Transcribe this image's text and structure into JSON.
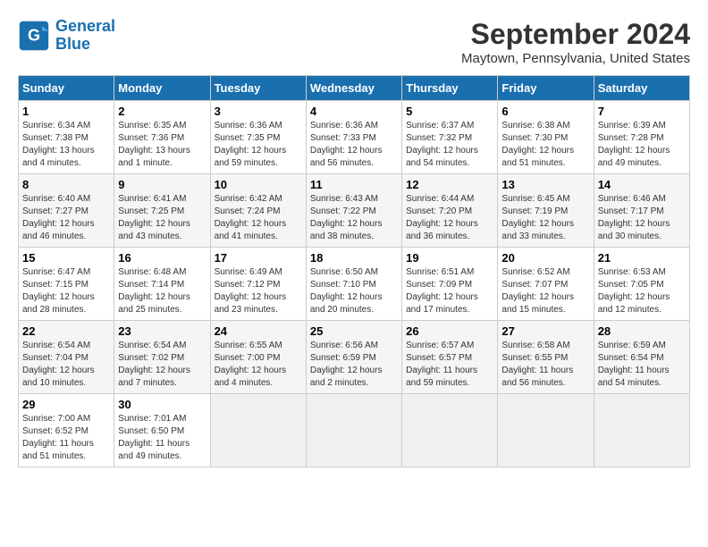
{
  "header": {
    "logo_line1": "General",
    "logo_line2": "Blue",
    "title": "September 2024",
    "subtitle": "Maytown, Pennsylvania, United States"
  },
  "weekdays": [
    "Sunday",
    "Monday",
    "Tuesday",
    "Wednesday",
    "Thursday",
    "Friday",
    "Saturday"
  ],
  "weeks": [
    [
      {
        "day": "1",
        "info": "Sunrise: 6:34 AM\nSunset: 7:38 PM\nDaylight: 13 hours and 4 minutes."
      },
      {
        "day": "2",
        "info": "Sunrise: 6:35 AM\nSunset: 7:36 PM\nDaylight: 13 hours and 1 minute."
      },
      {
        "day": "3",
        "info": "Sunrise: 6:36 AM\nSunset: 7:35 PM\nDaylight: 12 hours and 59 minutes."
      },
      {
        "day": "4",
        "info": "Sunrise: 6:36 AM\nSunset: 7:33 PM\nDaylight: 12 hours and 56 minutes."
      },
      {
        "day": "5",
        "info": "Sunrise: 6:37 AM\nSunset: 7:32 PM\nDaylight: 12 hours and 54 minutes."
      },
      {
        "day": "6",
        "info": "Sunrise: 6:38 AM\nSunset: 7:30 PM\nDaylight: 12 hours and 51 minutes."
      },
      {
        "day": "7",
        "info": "Sunrise: 6:39 AM\nSunset: 7:28 PM\nDaylight: 12 hours and 49 minutes."
      }
    ],
    [
      {
        "day": "8",
        "info": "Sunrise: 6:40 AM\nSunset: 7:27 PM\nDaylight: 12 hours and 46 minutes."
      },
      {
        "day": "9",
        "info": "Sunrise: 6:41 AM\nSunset: 7:25 PM\nDaylight: 12 hours and 43 minutes."
      },
      {
        "day": "10",
        "info": "Sunrise: 6:42 AM\nSunset: 7:24 PM\nDaylight: 12 hours and 41 minutes."
      },
      {
        "day": "11",
        "info": "Sunrise: 6:43 AM\nSunset: 7:22 PM\nDaylight: 12 hours and 38 minutes."
      },
      {
        "day": "12",
        "info": "Sunrise: 6:44 AM\nSunset: 7:20 PM\nDaylight: 12 hours and 36 minutes."
      },
      {
        "day": "13",
        "info": "Sunrise: 6:45 AM\nSunset: 7:19 PM\nDaylight: 12 hours and 33 minutes."
      },
      {
        "day": "14",
        "info": "Sunrise: 6:46 AM\nSunset: 7:17 PM\nDaylight: 12 hours and 30 minutes."
      }
    ],
    [
      {
        "day": "15",
        "info": "Sunrise: 6:47 AM\nSunset: 7:15 PM\nDaylight: 12 hours and 28 minutes."
      },
      {
        "day": "16",
        "info": "Sunrise: 6:48 AM\nSunset: 7:14 PM\nDaylight: 12 hours and 25 minutes."
      },
      {
        "day": "17",
        "info": "Sunrise: 6:49 AM\nSunset: 7:12 PM\nDaylight: 12 hours and 23 minutes."
      },
      {
        "day": "18",
        "info": "Sunrise: 6:50 AM\nSunset: 7:10 PM\nDaylight: 12 hours and 20 minutes."
      },
      {
        "day": "19",
        "info": "Sunrise: 6:51 AM\nSunset: 7:09 PM\nDaylight: 12 hours and 17 minutes."
      },
      {
        "day": "20",
        "info": "Sunrise: 6:52 AM\nSunset: 7:07 PM\nDaylight: 12 hours and 15 minutes."
      },
      {
        "day": "21",
        "info": "Sunrise: 6:53 AM\nSunset: 7:05 PM\nDaylight: 12 hours and 12 minutes."
      }
    ],
    [
      {
        "day": "22",
        "info": "Sunrise: 6:54 AM\nSunset: 7:04 PM\nDaylight: 12 hours and 10 minutes."
      },
      {
        "day": "23",
        "info": "Sunrise: 6:54 AM\nSunset: 7:02 PM\nDaylight: 12 hours and 7 minutes."
      },
      {
        "day": "24",
        "info": "Sunrise: 6:55 AM\nSunset: 7:00 PM\nDaylight: 12 hours and 4 minutes."
      },
      {
        "day": "25",
        "info": "Sunrise: 6:56 AM\nSunset: 6:59 PM\nDaylight: 12 hours and 2 minutes."
      },
      {
        "day": "26",
        "info": "Sunrise: 6:57 AM\nSunset: 6:57 PM\nDaylight: 11 hours and 59 minutes."
      },
      {
        "day": "27",
        "info": "Sunrise: 6:58 AM\nSunset: 6:55 PM\nDaylight: 11 hours and 56 minutes."
      },
      {
        "day": "28",
        "info": "Sunrise: 6:59 AM\nSunset: 6:54 PM\nDaylight: 11 hours and 54 minutes."
      }
    ],
    [
      {
        "day": "29",
        "info": "Sunrise: 7:00 AM\nSunset: 6:52 PM\nDaylight: 11 hours and 51 minutes."
      },
      {
        "day": "30",
        "info": "Sunrise: 7:01 AM\nSunset: 6:50 PM\nDaylight: 11 hours and 49 minutes."
      },
      {
        "day": "",
        "info": ""
      },
      {
        "day": "",
        "info": ""
      },
      {
        "day": "",
        "info": ""
      },
      {
        "day": "",
        "info": ""
      },
      {
        "day": "",
        "info": ""
      }
    ]
  ]
}
